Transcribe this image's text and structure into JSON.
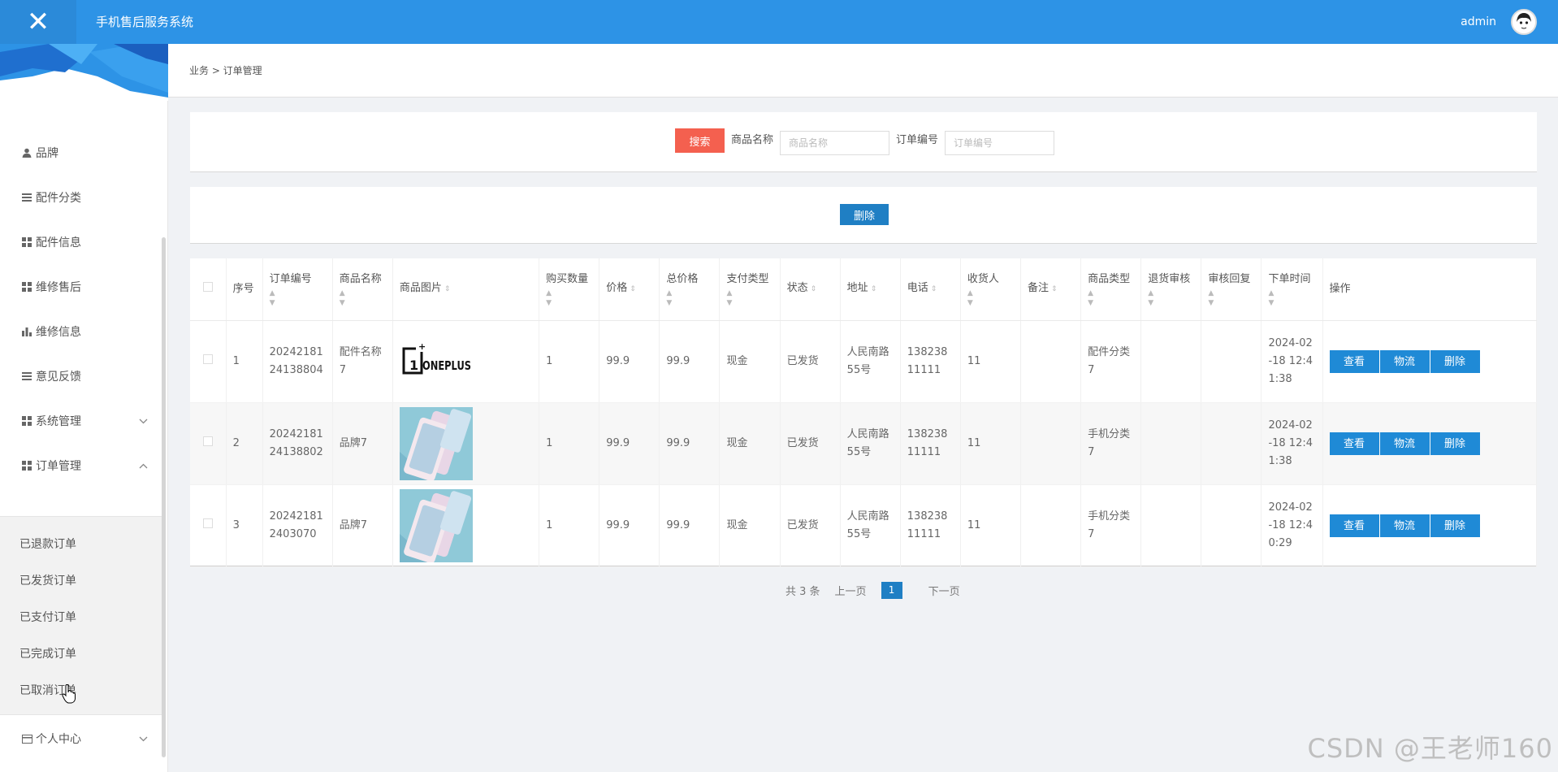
{
  "header": {
    "close_icon": "close-icon",
    "app_title": "手机售后服务系统",
    "user_name": "admin"
  },
  "sidebar": {
    "items": [
      {
        "label": "品牌",
        "icon": "user-icon"
      },
      {
        "label": "配件分类",
        "icon": "list-icon"
      },
      {
        "label": "配件信息",
        "icon": "grid-icon"
      },
      {
        "label": "维修售后",
        "icon": "grid-icon"
      },
      {
        "label": "维修信息",
        "icon": "bar-chart-icon"
      },
      {
        "label": "意见反馈",
        "icon": "list-icon"
      },
      {
        "label": "系统管理",
        "icon": "grid-icon",
        "chevron": "down"
      },
      {
        "label": "订单管理",
        "icon": "grid-icon",
        "chevron": "up"
      },
      {
        "label": "个人中心",
        "icon": "card-icon",
        "chevron": "down"
      }
    ],
    "submenu": [
      "已退款订单",
      "已发货订单",
      "已支付订单",
      "已完成订单",
      "已取消订单"
    ]
  },
  "breadcrumb": "业务 > 订单管理",
  "search": {
    "button": "搜索",
    "name_label": "商品名称",
    "name_placeholder": "商品名称",
    "order_label": "订单编号",
    "order_placeholder": "订单编号"
  },
  "actions": {
    "delete_label": "删除"
  },
  "table": {
    "headers": [
      "序号",
      "订单编号",
      "商品名称",
      "商品图片",
      "购买数量",
      "价格",
      "总价格",
      "支付类型",
      "状态",
      "地址",
      "电话",
      "收货人",
      "备注",
      "商品类型",
      "退货审核",
      "审核回复",
      "下单时间",
      "操作"
    ],
    "rows": [
      {
        "no": "1",
        "order_no": "2024218124138804",
        "name": "配件名称7",
        "image": "oneplus-logo",
        "qty": "1",
        "price": "99.9",
        "total": "99.9",
        "pay": "现金",
        "status": "已发货",
        "addr": "人民南路55号",
        "phone": "13823811111",
        "receiver": "11",
        "remark": "",
        "type": "配件分类7",
        "return": "",
        "reply": "",
        "time": "2024-02-18 12:41:38"
      },
      {
        "no": "2",
        "order_no": "2024218124138802",
        "name": "品牌7",
        "image": "phone-photo",
        "qty": "1",
        "price": "99.9",
        "total": "99.9",
        "pay": "现金",
        "status": "已发货",
        "addr": "人民南路55号",
        "phone": "13823811111",
        "receiver": "11",
        "remark": "",
        "type": "手机分类7",
        "return": "",
        "reply": "",
        "time": "2024-02-18 12:41:38"
      },
      {
        "no": "3",
        "order_no": "202421812403070",
        "name": "品牌7",
        "image": "phone-photo",
        "qty": "1",
        "price": "99.9",
        "total": "99.9",
        "pay": "现金",
        "status": "已发货",
        "addr": "人民南路55号",
        "phone": "13823811111",
        "receiver": "11",
        "remark": "",
        "type": "手机分类7",
        "return": "",
        "reply": "",
        "time": "2024-02-18 12:40:29"
      }
    ],
    "op_buttons": [
      "查看",
      "物流",
      "删除"
    ]
  },
  "pagination": {
    "total": "共 3 条",
    "prev": "上一页",
    "current": "1",
    "next": "下一页"
  },
  "watermark": "CSDN @王老师160"
}
